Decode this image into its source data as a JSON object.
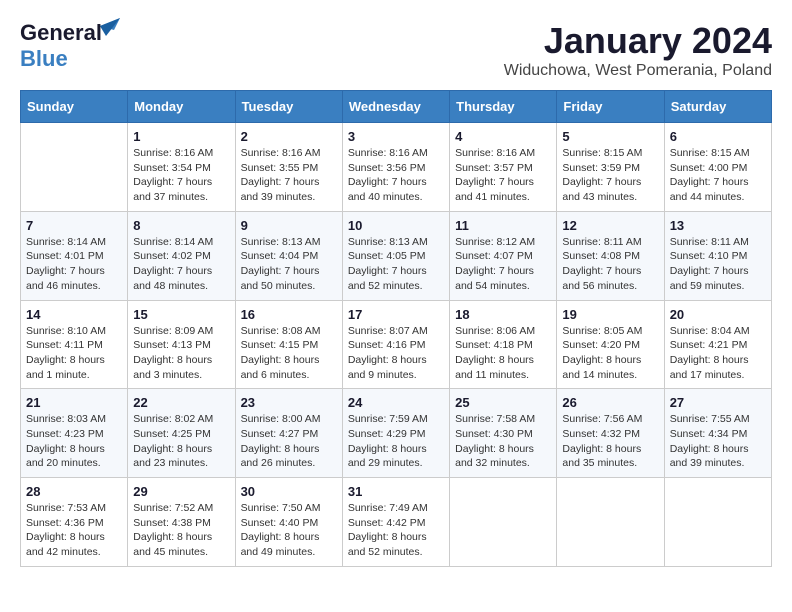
{
  "header": {
    "logo_general": "General",
    "logo_blue": "Blue",
    "month": "January 2024",
    "location": "Widuchowa, West Pomerania, Poland"
  },
  "days_of_week": [
    "Sunday",
    "Monday",
    "Tuesday",
    "Wednesday",
    "Thursday",
    "Friday",
    "Saturday"
  ],
  "weeks": [
    [
      {
        "day": "",
        "info": ""
      },
      {
        "day": "1",
        "info": "Sunrise: 8:16 AM\nSunset: 3:54 PM\nDaylight: 7 hours\nand 37 minutes."
      },
      {
        "day": "2",
        "info": "Sunrise: 8:16 AM\nSunset: 3:55 PM\nDaylight: 7 hours\nand 39 minutes."
      },
      {
        "day": "3",
        "info": "Sunrise: 8:16 AM\nSunset: 3:56 PM\nDaylight: 7 hours\nand 40 minutes."
      },
      {
        "day": "4",
        "info": "Sunrise: 8:16 AM\nSunset: 3:57 PM\nDaylight: 7 hours\nand 41 minutes."
      },
      {
        "day": "5",
        "info": "Sunrise: 8:15 AM\nSunset: 3:59 PM\nDaylight: 7 hours\nand 43 minutes."
      },
      {
        "day": "6",
        "info": "Sunrise: 8:15 AM\nSunset: 4:00 PM\nDaylight: 7 hours\nand 44 minutes."
      }
    ],
    [
      {
        "day": "7",
        "info": "Sunrise: 8:14 AM\nSunset: 4:01 PM\nDaylight: 7 hours\nand 46 minutes."
      },
      {
        "day": "8",
        "info": "Sunrise: 8:14 AM\nSunset: 4:02 PM\nDaylight: 7 hours\nand 48 minutes."
      },
      {
        "day": "9",
        "info": "Sunrise: 8:13 AM\nSunset: 4:04 PM\nDaylight: 7 hours\nand 50 minutes."
      },
      {
        "day": "10",
        "info": "Sunrise: 8:13 AM\nSunset: 4:05 PM\nDaylight: 7 hours\nand 52 minutes."
      },
      {
        "day": "11",
        "info": "Sunrise: 8:12 AM\nSunset: 4:07 PM\nDaylight: 7 hours\nand 54 minutes."
      },
      {
        "day": "12",
        "info": "Sunrise: 8:11 AM\nSunset: 4:08 PM\nDaylight: 7 hours\nand 56 minutes."
      },
      {
        "day": "13",
        "info": "Sunrise: 8:11 AM\nSunset: 4:10 PM\nDaylight: 7 hours\nand 59 minutes."
      }
    ],
    [
      {
        "day": "14",
        "info": "Sunrise: 8:10 AM\nSunset: 4:11 PM\nDaylight: 8 hours\nand 1 minute."
      },
      {
        "day": "15",
        "info": "Sunrise: 8:09 AM\nSunset: 4:13 PM\nDaylight: 8 hours\nand 3 minutes."
      },
      {
        "day": "16",
        "info": "Sunrise: 8:08 AM\nSunset: 4:15 PM\nDaylight: 8 hours\nand 6 minutes."
      },
      {
        "day": "17",
        "info": "Sunrise: 8:07 AM\nSunset: 4:16 PM\nDaylight: 8 hours\nand 9 minutes."
      },
      {
        "day": "18",
        "info": "Sunrise: 8:06 AM\nSunset: 4:18 PM\nDaylight: 8 hours\nand 11 minutes."
      },
      {
        "day": "19",
        "info": "Sunrise: 8:05 AM\nSunset: 4:20 PM\nDaylight: 8 hours\nand 14 minutes."
      },
      {
        "day": "20",
        "info": "Sunrise: 8:04 AM\nSunset: 4:21 PM\nDaylight: 8 hours\nand 17 minutes."
      }
    ],
    [
      {
        "day": "21",
        "info": "Sunrise: 8:03 AM\nSunset: 4:23 PM\nDaylight: 8 hours\nand 20 minutes."
      },
      {
        "day": "22",
        "info": "Sunrise: 8:02 AM\nSunset: 4:25 PM\nDaylight: 8 hours\nand 23 minutes."
      },
      {
        "day": "23",
        "info": "Sunrise: 8:00 AM\nSunset: 4:27 PM\nDaylight: 8 hours\nand 26 minutes."
      },
      {
        "day": "24",
        "info": "Sunrise: 7:59 AM\nSunset: 4:29 PM\nDaylight: 8 hours\nand 29 minutes."
      },
      {
        "day": "25",
        "info": "Sunrise: 7:58 AM\nSunset: 4:30 PM\nDaylight: 8 hours\nand 32 minutes."
      },
      {
        "day": "26",
        "info": "Sunrise: 7:56 AM\nSunset: 4:32 PM\nDaylight: 8 hours\nand 35 minutes."
      },
      {
        "day": "27",
        "info": "Sunrise: 7:55 AM\nSunset: 4:34 PM\nDaylight: 8 hours\nand 39 minutes."
      }
    ],
    [
      {
        "day": "28",
        "info": "Sunrise: 7:53 AM\nSunset: 4:36 PM\nDaylight: 8 hours\nand 42 minutes."
      },
      {
        "day": "29",
        "info": "Sunrise: 7:52 AM\nSunset: 4:38 PM\nDaylight: 8 hours\nand 45 minutes."
      },
      {
        "day": "30",
        "info": "Sunrise: 7:50 AM\nSunset: 4:40 PM\nDaylight: 8 hours\nand 49 minutes."
      },
      {
        "day": "31",
        "info": "Sunrise: 7:49 AM\nSunset: 4:42 PM\nDaylight: 8 hours\nand 52 minutes."
      },
      {
        "day": "",
        "info": ""
      },
      {
        "day": "",
        "info": ""
      },
      {
        "day": "",
        "info": ""
      }
    ]
  ]
}
